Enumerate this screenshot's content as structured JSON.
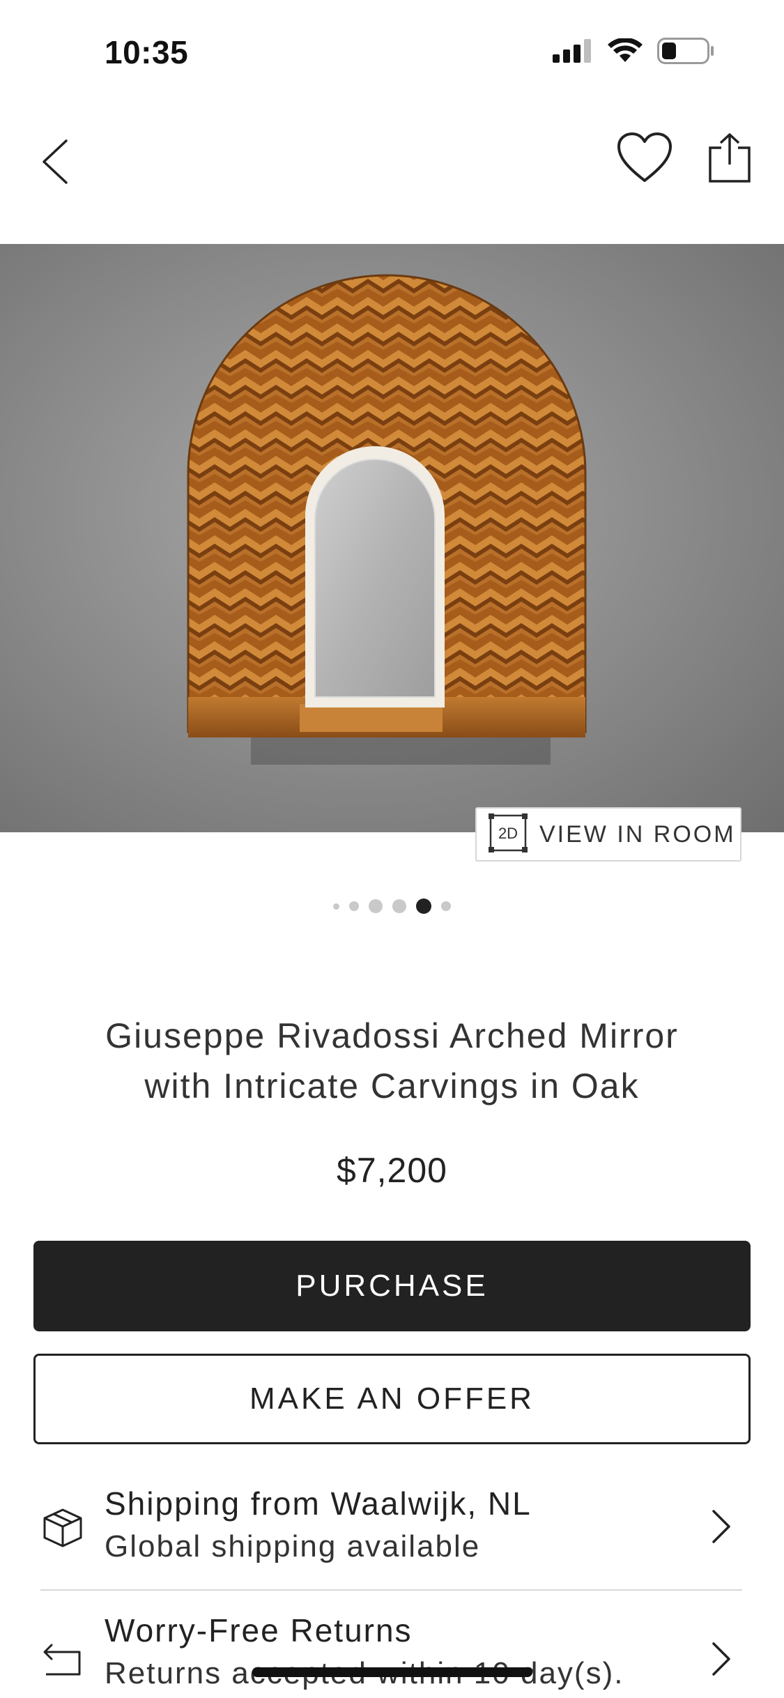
{
  "status_bar": {
    "time": "10:35",
    "icons": [
      "signal-icon",
      "wifi-icon",
      "battery-icon"
    ]
  },
  "nav": {
    "back_icon": "chevron-left-icon",
    "favorite_icon": "heart-icon",
    "share_icon": "share-icon"
  },
  "hero": {
    "view_in_room_badge": "2D",
    "view_in_room_label": "VIEW IN ROOM",
    "pager": {
      "count": 6,
      "active_index": 4
    }
  },
  "product": {
    "title_line1": "Giuseppe Rivadossi Arched Mirror",
    "title_line2": "with Intricate Carvings in Oak",
    "price": "$7,200"
  },
  "actions": {
    "purchase_label": "PURCHASE",
    "offer_label": "MAKE AN OFFER"
  },
  "info": {
    "shipping": {
      "icon": "box-icon",
      "title": "Shipping from Waalwijk, NL",
      "subtitle": "Global shipping available"
    },
    "returns": {
      "icon": "return-arrow-icon",
      "title": "Worry-Free Returns",
      "subtitle": "Returns accepted within 10 day(s)."
    }
  },
  "colors": {
    "primary_button": "#222222",
    "text": "#222222",
    "wood": "#b5651d",
    "wall": "#8f8f8f"
  }
}
